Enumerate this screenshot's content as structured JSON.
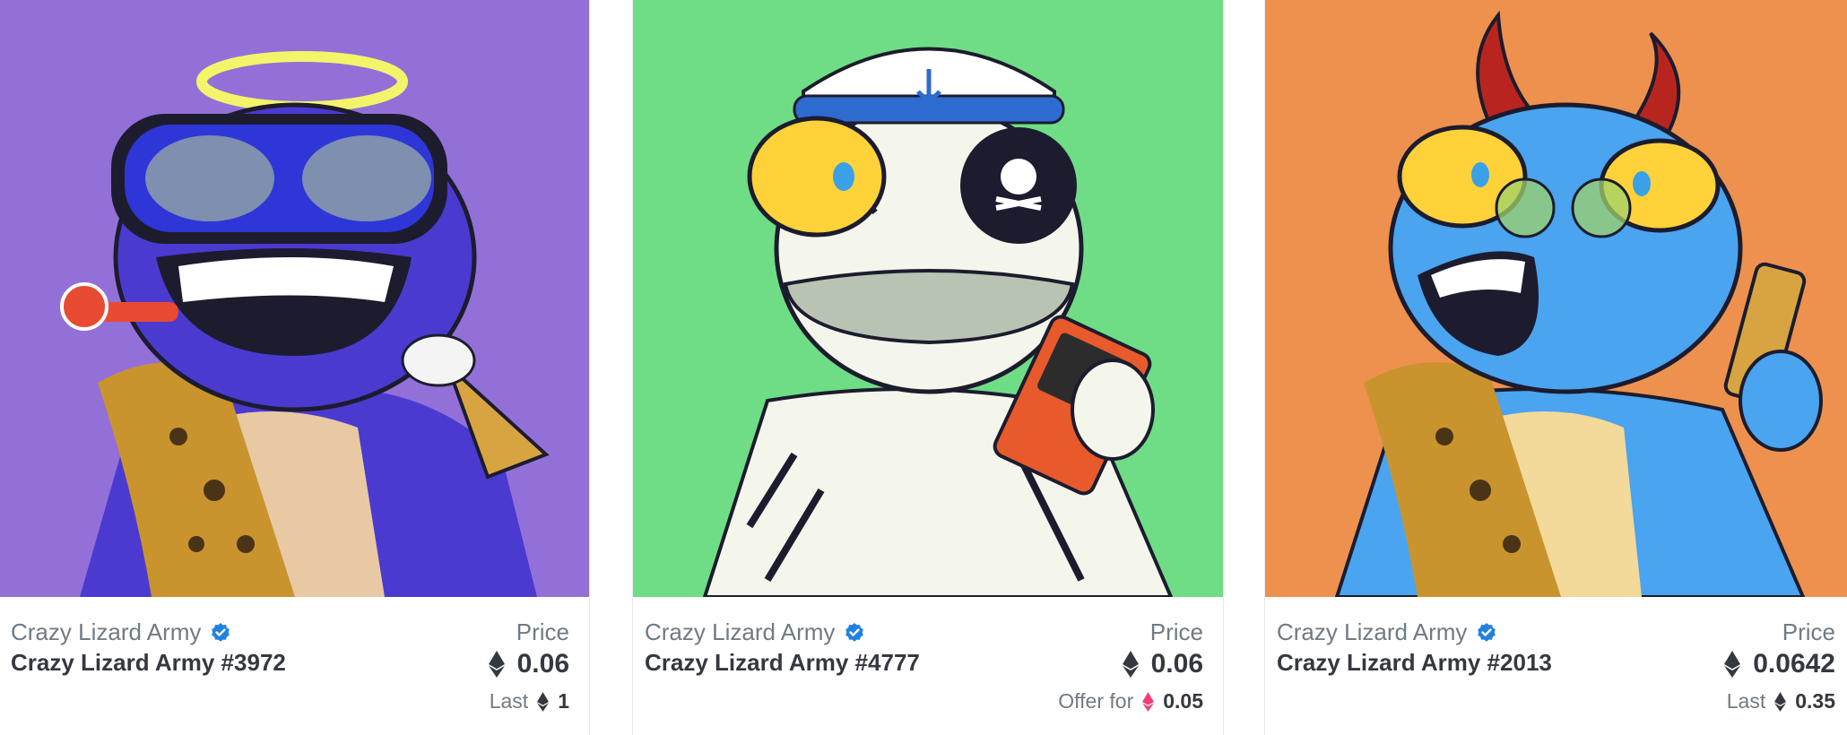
{
  "cards": [
    {
      "collection": "Crazy Lizard Army",
      "verified_icon": "verified-badge-icon",
      "token_name": "Crazy Lizard Army #3972",
      "price_label": "Price",
      "price_value": "0.06",
      "price_currency_icon": "eth-icon",
      "sub_label": "Last",
      "sub_value": "1",
      "sub_currency_icon": "eth-icon",
      "background": "#9370d8"
    },
    {
      "collection": "Crazy Lizard Army",
      "verified_icon": "verified-badge-icon",
      "token_name": "Crazy Lizard Army #4777",
      "price_label": "Price",
      "price_value": "0.06",
      "price_currency_icon": "eth-icon",
      "sub_label": "Offer for",
      "sub_value": "0.05",
      "sub_currency_icon": "weth-icon",
      "background": "#6fdd86"
    },
    {
      "collection": "Crazy Lizard Army",
      "verified_icon": "verified-badge-icon",
      "token_name": "Crazy Lizard Army #2013",
      "price_label": "Price",
      "price_value": "0.0642",
      "price_currency_icon": "eth-icon",
      "sub_label": "Last",
      "sub_value": "0.35",
      "sub_currency_icon": "eth-icon",
      "background": "#ee914e"
    }
  ],
  "colors": {
    "verified": "#2081e2",
    "eth": "#353840",
    "weth": "#ec407a"
  }
}
